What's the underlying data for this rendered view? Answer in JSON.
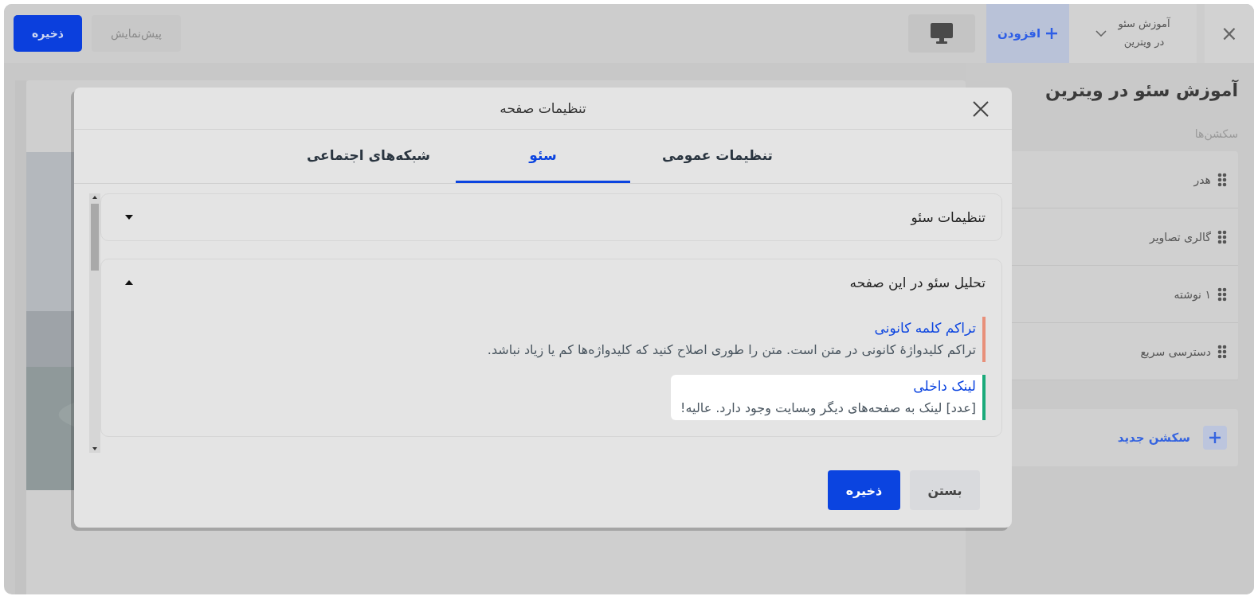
{
  "top_bar": {
    "close_label": "×",
    "project": {
      "line_1": "آموزش سئو",
      "line_2": "در ویترین"
    },
    "add_button": "افزودن",
    "preview_button": "پیش‌نمایش",
    "save_button": "ذخیره"
  },
  "sidebar": {
    "title": "آموزش سئو در ویترین",
    "sections_label": "سکشن‌ها",
    "sections": [
      {
        "label": "هدر"
      },
      {
        "label": "گالری تصاویر"
      },
      {
        "label": "۱ نوشته"
      },
      {
        "label": "دسترسی سریع"
      }
    ],
    "new_section": "سکشن جدید"
  },
  "modal": {
    "title": "تنظیمات صفحه",
    "tabs": [
      {
        "label": "تنظیمات عمومی",
        "selected": false
      },
      {
        "label": "سئو",
        "selected": true
      },
      {
        "label": "شبکه‌های اجتماعی",
        "selected": false
      }
    ],
    "accordions": [
      {
        "title": "تنظیمات سئو",
        "expanded": false
      },
      {
        "title": "تحلیل سئو در این صفحه",
        "expanded": true,
        "items": [
          {
            "title": "تراکم کلمه کانونی",
            "text": "تراکم کلیدواژهٔ کانونی در متن است. متن را طوری اصلاح کنید که کلیدواژه‌ها کم یا زیاد نباشد.",
            "color": "#e8907a",
            "highlighted": false
          },
          {
            "title": "لینک داخلی",
            "text": "[عدد] لینک به صفحه‌های دیگر وبسایت وجود دارد. عالیه!",
            "color": "#1aaa7a",
            "highlighted": true
          }
        ]
      }
    ],
    "buttons": [
      {
        "label": "بستن",
        "kind": "secondary"
      },
      {
        "label": "ذخیره",
        "kind": "primary"
      }
    ]
  }
}
